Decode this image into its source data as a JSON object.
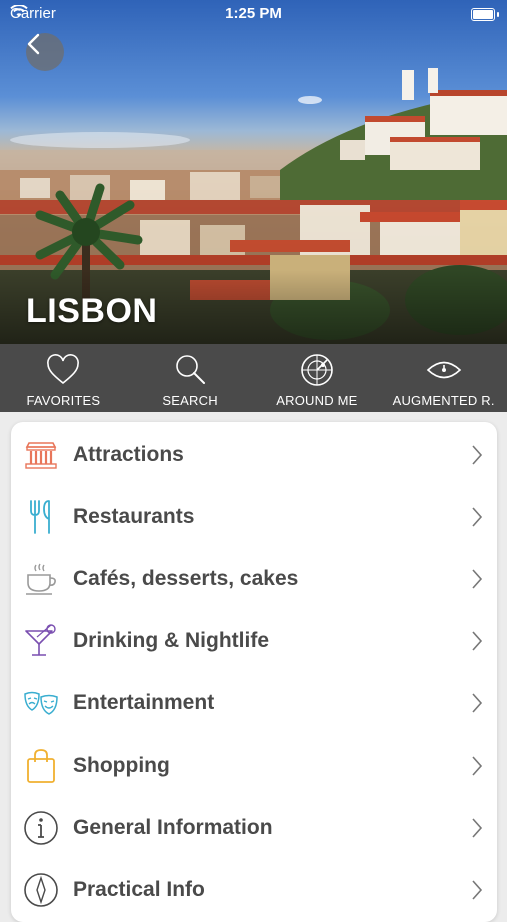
{
  "status": {
    "carrier": "Carrier",
    "time": "1:25 PM"
  },
  "hero": {
    "city": "LISBON"
  },
  "toolbar": [
    {
      "label": "FAVORITES",
      "icon": "heart-icon"
    },
    {
      "label": "SEARCH",
      "icon": "search-icon"
    },
    {
      "label": "AROUND ME",
      "icon": "radar-icon"
    },
    {
      "label": "AUGMENTED R.",
      "icon": "eye-icon"
    }
  ],
  "menu": [
    {
      "label": "Attractions",
      "icon": "monument-icon",
      "color": "#e8765a"
    },
    {
      "label": "Restaurants",
      "icon": "fork-knife-icon",
      "color": "#3aaed0"
    },
    {
      "label": "Cafés, desserts, cakes",
      "icon": "coffee-cup-icon",
      "color": "#9a9a9a"
    },
    {
      "label": "Drinking & Nightlife",
      "icon": "cocktail-icon",
      "color": "#7a4fb0"
    },
    {
      "label": "Entertainment",
      "icon": "theater-masks-icon",
      "color": "#3aaed0"
    },
    {
      "label": "Shopping",
      "icon": "shopping-bag-icon",
      "color": "#f0b030"
    },
    {
      "label": "General Information",
      "icon": "info-icon",
      "color": "#4a4a4a"
    },
    {
      "label": "Practical Info",
      "icon": "compass-icon",
      "color": "#4a4a4a"
    }
  ],
  "colors": {
    "toolbar_bg": "#4a4a4a",
    "text": "#4a4a4a"
  }
}
